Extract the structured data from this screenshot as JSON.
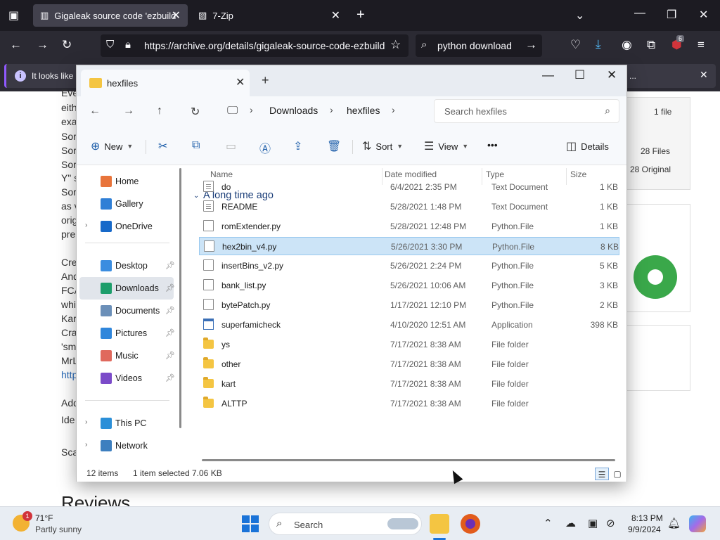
{
  "browser": {
    "tabs": [
      {
        "title": "Gigaleak source code 'ezbuild",
        "active": true
      },
      {
        "title": "7-Zip",
        "active": false
      }
    ],
    "url": "https://archive.org/details/gigaleak-source-code-ezbuild",
    "search_text": "python download",
    "extensions_badge": "6",
    "notification_text": "It looks like",
    "notification_tail": "..."
  },
  "webpage": {
    "text_fragments": [
      "Eve",
      "eith",
      "exa",
      "Sor",
      "Sor",
      "Sor",
      "Y\" s",
      "Sor",
      "as v",
      "origi",
      "pre",
      "Cre",
      "And",
      "FCA",
      "whi",
      "Kar",
      "Cra",
      "'sm",
      "MrL",
      "http",
      "Add",
      "Ide",
      "Sca"
    ],
    "info_card": [
      "1 file",
      "28 Files",
      "28 Original"
    ],
    "reviews_heading": "Reviews"
  },
  "explorer": {
    "tab_title": "hexfiles",
    "breadcrumb": [
      "Downloads",
      "hexfiles"
    ],
    "search_placeholder": "Search hexfiles",
    "toolbar": {
      "new_label": "New",
      "sort_label": "Sort",
      "view_label": "View",
      "more_label": "•••",
      "details_label": "Details"
    },
    "sidebar": [
      {
        "label": "Home",
        "icon": "home-icon",
        "color": "#e8743b"
      },
      {
        "label": "Gallery",
        "icon": "gallery-icon",
        "color": "#2f7fd6"
      },
      {
        "label": "OneDrive",
        "icon": "onedrive-icon",
        "color": "#1769c9"
      },
      {
        "label": "Desktop",
        "icon": "desktop-icon",
        "color": "#3b8de0"
      },
      {
        "label": "Downloads",
        "icon": "downloads-icon",
        "color": "#1d9e6b"
      },
      {
        "label": "Documents",
        "icon": "documents-icon",
        "color": "#6b8fb8"
      },
      {
        "label": "Pictures",
        "icon": "pictures-icon",
        "color": "#2f86db"
      },
      {
        "label": "Music",
        "icon": "music-icon",
        "color": "#e0695d"
      },
      {
        "label": "Videos",
        "icon": "videos-icon",
        "color": "#7b4bc9"
      },
      {
        "label": "This PC",
        "icon": "this-pc-icon",
        "color": "#2b8fd8"
      },
      {
        "label": "Network",
        "icon": "network-icon",
        "color": "#3d7fbf"
      }
    ],
    "columns": {
      "name": "Name",
      "date": "Date modified",
      "type": "Type",
      "size": "Size"
    },
    "group_label": "A long time ago",
    "files": [
      {
        "name": "do",
        "date": "6/4/2021 2:35 PM",
        "type": "Text Document",
        "size": "1 KB",
        "kind": "doc"
      },
      {
        "name": "README",
        "date": "5/28/2021 1:48 PM",
        "type": "Text Document",
        "size": "1 KB",
        "kind": "doc"
      },
      {
        "name": "romExtender.py",
        "date": "5/28/2021 12:48 PM",
        "type": "Python.File",
        "size": "1 KB",
        "kind": "py"
      },
      {
        "name": "hex2bin_v4.py",
        "date": "5/26/2021 3:30 PM",
        "type": "Python.File",
        "size": "8 KB",
        "kind": "py",
        "selected": true
      },
      {
        "name": "insertBins_v2.py",
        "date": "5/26/2021 2:24 PM",
        "type": "Python.File",
        "size": "5 KB",
        "kind": "py"
      },
      {
        "name": "bank_list.py",
        "date": "5/26/2021 10:06 AM",
        "type": "Python.File",
        "size": "3 KB",
        "kind": "py"
      },
      {
        "name": "bytePatch.py",
        "date": "1/17/2021 12:10 PM",
        "type": "Python.File",
        "size": "2 KB",
        "kind": "py"
      },
      {
        "name": "superfamicheck",
        "date": "4/10/2020 12:51 AM",
        "type": "Application",
        "size": "398 KB",
        "kind": "app"
      },
      {
        "name": "ys",
        "date": "7/17/2021 8:38 AM",
        "type": "File folder",
        "size": "",
        "kind": "folder"
      },
      {
        "name": "other",
        "date": "7/17/2021 8:38 AM",
        "type": "File folder",
        "size": "",
        "kind": "folder"
      },
      {
        "name": "kart",
        "date": "7/17/2021 8:38 AM",
        "type": "File folder",
        "size": "",
        "kind": "folder"
      },
      {
        "name": "ALTTP",
        "date": "7/17/2021 8:38 AM",
        "type": "File folder",
        "size": "",
        "kind": "folder"
      }
    ],
    "status": {
      "items": "12 items",
      "selected": "1 item selected",
      "size": "7.06 KB"
    }
  },
  "taskbar": {
    "weather_temp": "71°F",
    "weather_desc": "Partly sunny",
    "weather_badge": "1",
    "search_label": "Search",
    "time": "8:13 PM",
    "date": "9/9/2024"
  }
}
